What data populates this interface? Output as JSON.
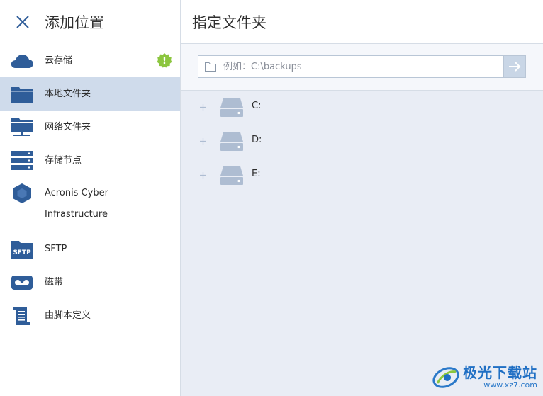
{
  "sidebar": {
    "title": "添加位置",
    "items": [
      {
        "label": "云存储",
        "icon": "cloud-icon",
        "badge": "!"
      },
      {
        "label": "本地文件夹",
        "icon": "local-folder-icon",
        "selected": true
      },
      {
        "label": "网络文件夹",
        "icon": "network-folder-icon"
      },
      {
        "label": "存储节点",
        "icon": "storage-node-icon"
      },
      {
        "label_line1": "Acronis Cyber",
        "label_line2": "Infrastructure",
        "icon": "acronis-hexagon-icon"
      },
      {
        "label": "SFTP",
        "icon": "sftp-folder-icon",
        "icon_text": "SFTP"
      },
      {
        "label": "磁带",
        "icon": "tape-icon"
      },
      {
        "label": "由脚本定义",
        "icon": "script-icon"
      }
    ]
  },
  "main": {
    "title": "指定文件夹",
    "path_input": {
      "placeholder": "例如：C:\\backups",
      "value": ""
    },
    "drives": [
      {
        "label": "C:",
        "icon": "drive-icon"
      },
      {
        "label": "D:",
        "icon": "drive-icon"
      },
      {
        "label": "E:",
        "icon": "drive-icon"
      }
    ]
  },
  "watermark": {
    "title": "极光下载站",
    "url": "www.xz7.com"
  },
  "colors": {
    "accent": "#2f5d99",
    "selected_bg": "#cfdbeb",
    "badge_green": "#8cc63f",
    "drive_gray": "#aebdd2",
    "main_bg": "#e9edf5"
  }
}
